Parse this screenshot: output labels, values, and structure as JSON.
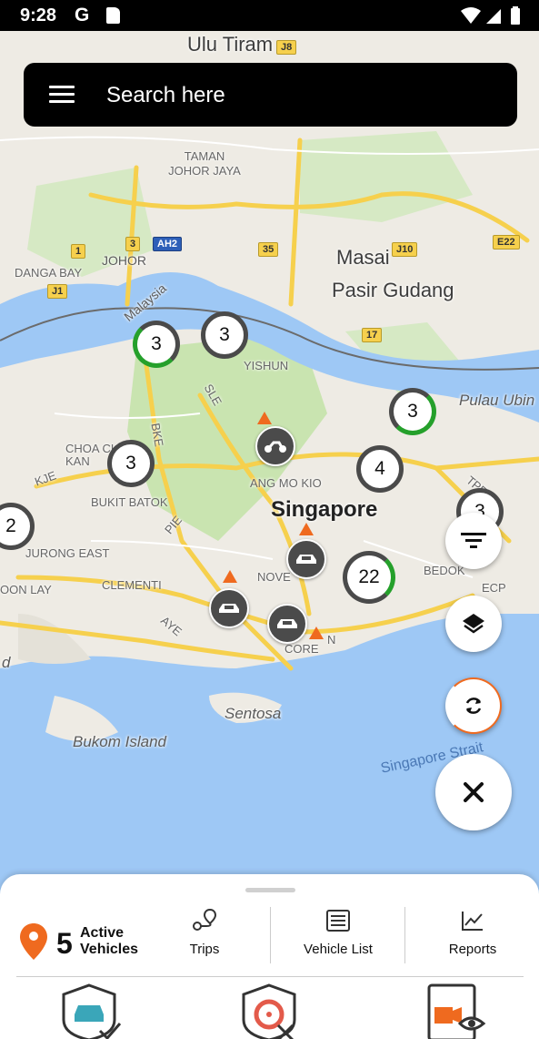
{
  "status_bar": {
    "time": "9:28",
    "g_icon": "G"
  },
  "search": {
    "placeholder": "Search here"
  },
  "map": {
    "labels": {
      "ulu_tiram": "Ulu Tiram",
      "taman_johor_jaya": "TAMAN\nJOHOR JAYA",
      "johor": "JOHOR",
      "danga_bay": "DANGA BAY",
      "malaysia": "Malaysia",
      "masai": "Masai",
      "pasir_gudang": "Pasir Gudang",
      "yishun": "YISHUN",
      "pulau_ubin": "Pulau Ubin",
      "choa_chu_kang": "CHOA CH\nKAN",
      "bukit_batok": "BUKIT BATOK",
      "ang_mo_kio": "ANG MO KIO",
      "singapore": "Singapore",
      "jurong_east": "JURONG EAST",
      "clementi": "CLEMENTI",
      "boon_lay": "OON LAY",
      "novena": "NOVE",
      "bedok": "BEDOK",
      "sentosa": "Sentosa",
      "bukom_island": "Bukom Island",
      "singapore_strait": "Singapore Strait",
      "core": "CORE",
      "pie": "PIE",
      "bke": "BKE",
      "sle": "SLE",
      "kje": "KJE",
      "aye": "AYE",
      "tpe": "TPE",
      "ecp": "ECP",
      "d_label": "d",
      "n_label": "N"
    },
    "shields": [
      "J8",
      "AH2",
      "3",
      "1",
      "J1",
      "35",
      "J10",
      "E22",
      "17"
    ],
    "clusters": [
      {
        "count": "3"
      },
      {
        "count": "3"
      },
      {
        "count": "3"
      },
      {
        "count": "3"
      },
      {
        "count": "4"
      },
      {
        "count": "2"
      },
      {
        "count": "3"
      },
      {
        "count": "22"
      }
    ]
  },
  "controls": {
    "filter_icon": "filter-icon",
    "layers_icon": "layers-icon",
    "refresh_icon": "refresh-icon",
    "close_icon": "close-icon"
  },
  "bottom_sheet": {
    "active_count": "5",
    "active_label": "Active Vehicles",
    "tabs": [
      {
        "label": "Trips",
        "icon": "trips-icon"
      },
      {
        "label": "Vehicle List",
        "icon": "list-icon"
      },
      {
        "label": "Reports",
        "icon": "chart-icon"
      }
    ],
    "bottom_icons": [
      "vehicle-shield-check-icon",
      "steering-shield-x-icon",
      "video-eye-icon"
    ]
  },
  "colors": {
    "accent": "#ef6a1f",
    "green": "#25a02b",
    "dark": "#000000",
    "water": "#9ec8f5"
  }
}
